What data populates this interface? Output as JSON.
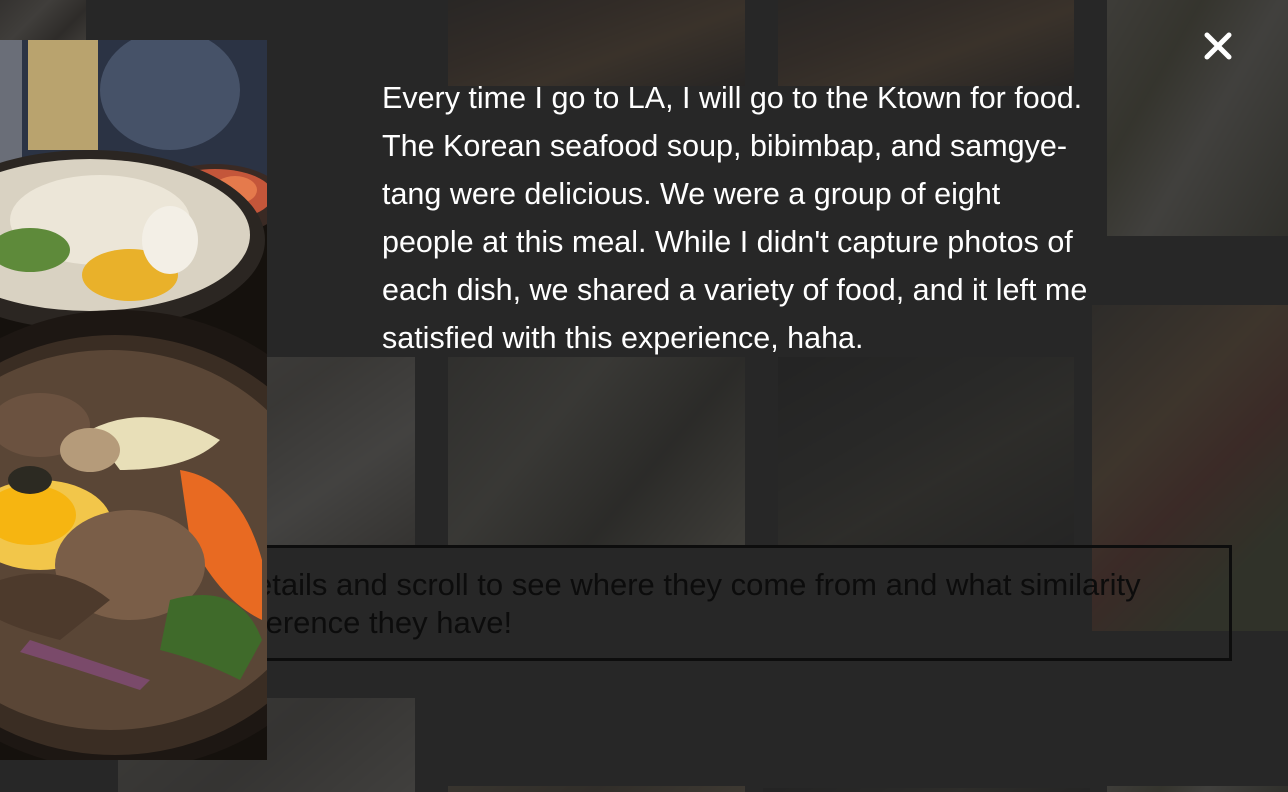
{
  "modal": {
    "story_lines": [
      "Every time I go to LA, I will go to the Ktown for food.",
      "The Korean seafood soup, bibimbap, and samgye-",
      "tang were delicious. We were a group of eight",
      "people at this meal. While I didn't capture photos of",
      "each dish, we shared a variety of food, and it left me",
      "satisfied with this experience, haha."
    ],
    "close_icon": "close-icon"
  },
  "background_caption": {
    "lines": [
      "etails and scroll to see where they come from and what similarity",
      "ference they have!"
    ]
  },
  "colors": {
    "overlay": "#262626",
    "story_text": "#ffffff",
    "caption_text": "#0c0c0c"
  }
}
